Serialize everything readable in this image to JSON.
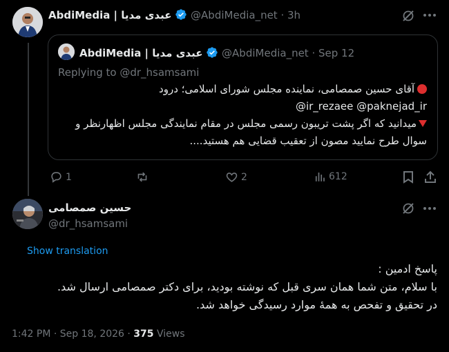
{
  "reply_tweet": {
    "author_name": "AbdiMedia | عبدی مدیا",
    "handle": "@AbdiMedia_net",
    "time": "3h",
    "quoted": {
      "author_name": "AbdiMedia | عبدی مدیا",
      "handle": "@AbdiMedia_net",
      "date": "Sep 12",
      "replying_to_prefix": "Replying to ",
      "replying_to_handle": "@dr_hsamsami",
      "line1": "آقای حسین صمصامی، نماینده مجلس شورای اسلامی؛ درود",
      "line2": "@ir_rezaee @paknejad_ir",
      "line3": "میدانید که اگر پشت تریبون رسمی مجلس در مقام نمایندگی مجلس اظهارنظر و",
      "line4": "سوال طرح نمایید مصون از تعقیب قضایی هم هستید...."
    },
    "actions": {
      "replies": "1",
      "retweets": "",
      "likes": "2",
      "views": "612"
    }
  },
  "main_tweet": {
    "author_name": "حسین صمصامی",
    "handle": "@dr_hsamsami",
    "show_translation": "Show translation",
    "body_line1": "پاسخ ادمین :",
    "body_line2": "با سلام، متن شما همان سری قبل که نوشته بودید، برای دکتر صمصامی ارسال شد.",
    "body_line3": "در تحقیق و تفحص به همهٔ موارد رسیدگی خواهد شد.",
    "timestamp": "1:42 PM · Sep 18, 2026 · ",
    "views_count": "375",
    "views_label": " Views"
  },
  "colors": {
    "background": "#000000",
    "text": "#e7e9ea",
    "muted": "#71767b",
    "link": "#1d9bf0",
    "border": "#2f3336",
    "verified": "#1d9bf0"
  },
  "icons": [
    "verified-badge-icon",
    "grok-icon",
    "more-icon",
    "red-circle-emoji",
    "red-triangle-emoji",
    "reply-icon",
    "retweet-icon",
    "like-icon",
    "views-icon",
    "bookmark-icon",
    "share-icon"
  ]
}
